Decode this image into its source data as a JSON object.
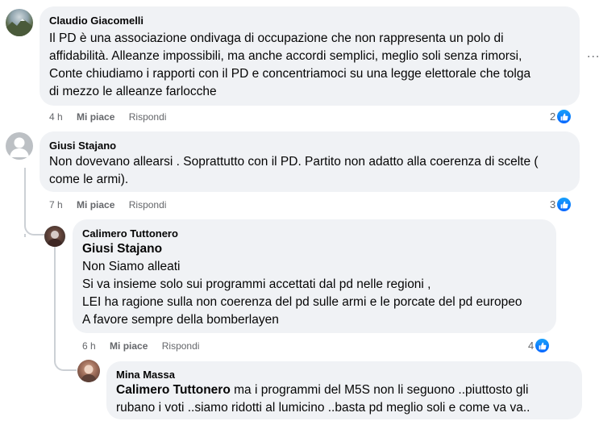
{
  "comments": [
    {
      "author": "Claudio Giacomelli",
      "lines": [
        "Il PD è una associazione ondivaga di occupazione che non rappresenta un polo di",
        "affidabilità. Alleanze impossibili, ma anche accordi semplici, meglio soli senza rimorsi,",
        "Conte chiudiamo i rapporti con il PD e concentriamoci su una legge elettorale che tolga",
        "di mezzo le alleanze farlocche"
      ],
      "time": "4 h",
      "like_label": "Mi piace",
      "reply_label": "Rispondi",
      "reactions": "2"
    },
    {
      "author": "Giusi Stajano",
      "lines": [
        "Non dovevano allearsi . Soprattutto con il PD. Partito non adatto alla coerenza di scelte (",
        "come le armi)."
      ],
      "time": "7 h",
      "like_label": "Mi piace",
      "reply_label": "Rispondi",
      "reactions": "3"
    },
    {
      "author": "Calimero Tuttonero",
      "mention": "Giusi Stajano",
      "lines": [
        "Non Siamo alleati",
        "Si va insieme solo sui programmi accettati dal pd nelle regioni ,",
        "LEI ha ragione sulla non coerenza del pd sulle armi e le porcate del pd europeo",
        "A favore sempre della bomberlayen"
      ],
      "time": "6 h",
      "like_label": "Mi piace",
      "reply_label": "Rispondi",
      "reactions": "4"
    },
    {
      "author": "Mina Massa",
      "mention": "Calimero Tuttonero",
      "first_line": " ma i programmi del M5S non li seguono ..piuttosto gli",
      "second_line": "rubano i voti ..siamo ridotti al lumicino ..basta pd meglio soli e come va va.."
    }
  ],
  "more_label": "...",
  "colors": {
    "bubble": "#f0f2f5",
    "meta": "#65676b",
    "like": "#0866ff"
  }
}
